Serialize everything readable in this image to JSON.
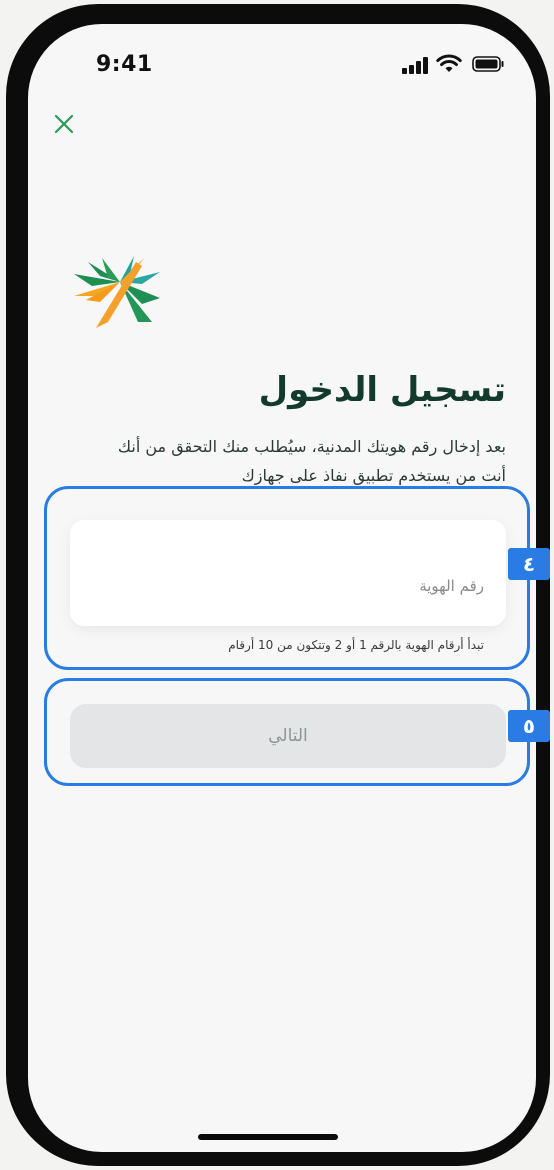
{
  "status_bar": {
    "time": "9:41"
  },
  "header": {
    "close_icon": "close-icon",
    "close_color": "#2e9a5a"
  },
  "logo": {
    "name": "palm-logo"
  },
  "login": {
    "title": "تسجيل الدخول",
    "description_lines": [
      "بعد إدخال رقم هويتك المدنية، سيُطلب منك التحقق من أنك",
      "أنت من يستخدم تطبيق نفاذ على جهازك"
    ],
    "id_placeholder": "رقم الهوية",
    "id_value": "",
    "id_hint": "تبدأ أرقام الهوية بالرقم 1 أو 2 وتتكون من 10 أرقام",
    "next_button": "التالي"
  },
  "annotations": {
    "badge_id_field": "٤",
    "badge_next_button": "٥",
    "accent": "#2b7be4"
  }
}
